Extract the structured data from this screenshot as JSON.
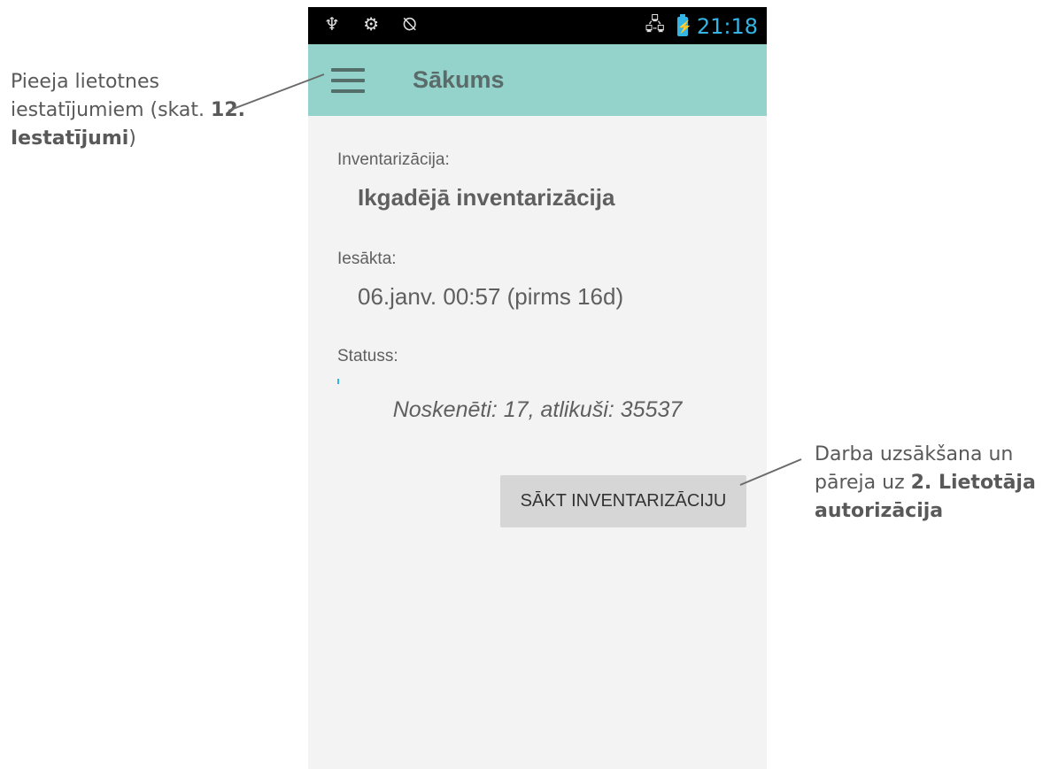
{
  "callouts": {
    "left": {
      "text1": "Pieeja lietotnes iestatījumiem (skat. ",
      "bold": "12. Iestatījumi",
      "text2": ")"
    },
    "right": {
      "text1": "Darba uzsākšana un pāreja uz ",
      "bold": "2. Lietotāja autorizācija"
    }
  },
  "statusbar": {
    "left_icons": [
      "usb-icon",
      "android-debug-icon",
      "sync-off-icon"
    ],
    "left_glyphs": "♆ ⚙ ⦰",
    "network_icon": "network-icon",
    "network_glyph": "🖧",
    "battery_icon": "battery-charging-icon",
    "battery_glyph": "⚡",
    "time": "21:18"
  },
  "appbar": {
    "menu_icon": "hamburger-menu-icon",
    "title": "Sākums"
  },
  "main": {
    "inventory_label": "Inventarizācija:",
    "inventory_value": "Ikgadējā inventarizācija",
    "started_label": "Iesākta:",
    "started_value": "06.janv. 00:57 (pirms 16d)",
    "status_label": "Statuss:",
    "status_value": "Noskenēti: 17, atlikuši: 35537",
    "start_button": "SĀKT INVENTARIZĀCIJU"
  },
  "colors": {
    "appbar": "#94d3cb",
    "accent": "#33b5e5",
    "background": "#f3f3f3"
  }
}
